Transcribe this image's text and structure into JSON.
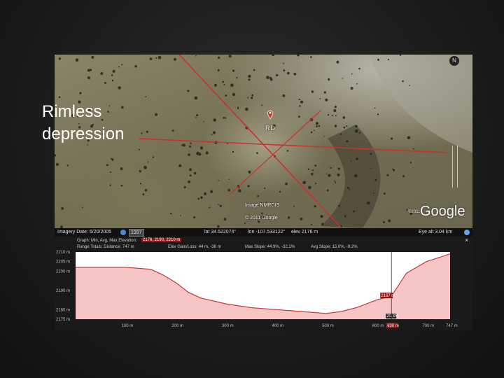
{
  "caption": {
    "line1": "Rimless",
    "line2": "depression"
  },
  "map": {
    "placemark_label": "RD",
    "imagery_credit_1": "Image NMRGIS",
    "imagery_credit_2": "© 2011 Google",
    "provider_logo": "Google",
    "copyright_small": "©2011",
    "compass_letter": "N",
    "line_color": "#c8332a"
  },
  "statusbar": {
    "imagery_date": "Imagery Date: 6/20/2005",
    "badge": "1997",
    "lat": "lat  34.522074°",
    "lon": "lon -107.533122°",
    "elev": "elev  2176 m",
    "eye_alt": "Eye alt   3.04 km"
  },
  "profile": {
    "graph_row": "Graph: Min, Avg, Max Elevation:",
    "elevation_values": "2176, 2190, 2210 m",
    "range_row": "Range Totals: Distance: 747 m",
    "elev_gain_loss": "Elev Gain/Loss: 44 m, -38 m",
    "max_slope": "Max Slope: 44.9%, -32.1%",
    "avg_slope": "Avg Slope: 15.0%, -9.2%",
    "marker_elev": "2187 m",
    "marker_slope": "20.3%",
    "marker_dist": "630 m",
    "close": "×",
    "color_fill": "#f6c6c6",
    "color_line": "#c43a3a"
  },
  "chart_data": {
    "type": "area",
    "title": "",
    "xlabel": "",
    "ylabel": "",
    "y_tick_labels": [
      "2210 m",
      "2205 m",
      "2200 m",
      "2190 m",
      "2180 m",
      "2175 m"
    ],
    "x_tick_labels": [
      "100 m",
      "200 m",
      "300 m",
      "400 m",
      "500 m",
      "600 m",
      "700 m",
      "747 m"
    ],
    "x": [
      0,
      50,
      100,
      150,
      175,
      200,
      225,
      250,
      300,
      350,
      400,
      450,
      500,
      530,
      560,
      600,
      630,
      660,
      700,
      747
    ],
    "y": [
      2202,
      2202,
      2202,
      2201,
      2198,
      2194,
      2189,
      2186,
      2183,
      2181,
      2180,
      2179,
      2178,
      2179,
      2181,
      2185,
      2187,
      2199,
      2205,
      2209
    ],
    "xlim": [
      0,
      747
    ],
    "ylim": [
      2175,
      2210
    ],
    "grid": false
  }
}
